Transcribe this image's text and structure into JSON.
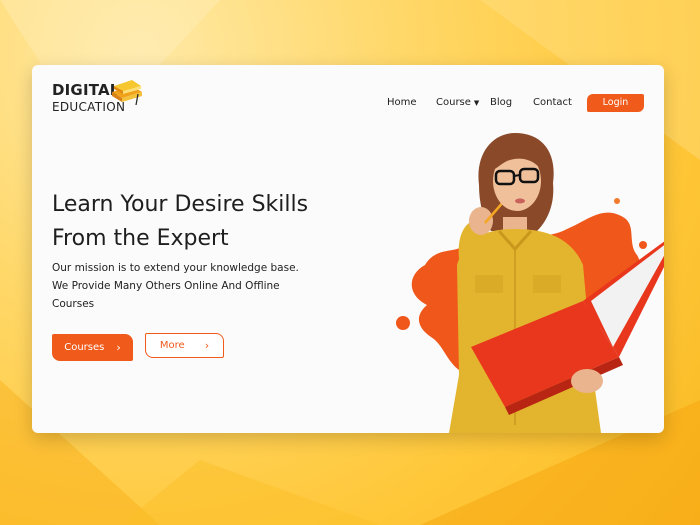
{
  "logo": {
    "top": "DIGITAL",
    "bottom": "EDUCATION",
    "icon": "book-stack-icon"
  },
  "nav": {
    "home": "Home",
    "course": "Course",
    "course_caret": "▼",
    "blog": "Blog",
    "contact": "Contact",
    "login": "Login"
  },
  "hero": {
    "headline_line1": "Learn Your Desire Skills",
    "headline_line2": "From the Expert",
    "desc_line1": "Our mission is to extend your knowledge base.",
    "desc_line2": "We Provide Many Others Online And Offline",
    "desc_line3": "Courses"
  },
  "buttons": {
    "courses": "Courses",
    "more": "More",
    "chevron": "›"
  },
  "colors": {
    "accent": "#f05a1a",
    "background": "#ffc83a",
    "card": "#fbfbfb",
    "shirt": "#e3b52e"
  }
}
